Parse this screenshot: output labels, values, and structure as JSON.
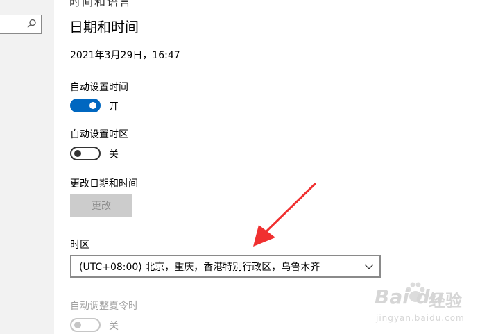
{
  "header": {
    "cut_text": "时间和语言"
  },
  "page": {
    "title": "日期和时间",
    "datetime": "2021年3月29日，16:47"
  },
  "settings": {
    "auto_time": {
      "label": "自动设置时间",
      "state": "开"
    },
    "auto_timezone": {
      "label": "自动设置时区",
      "state": "关"
    },
    "change_datetime": {
      "label": "更改日期和时间",
      "button": "更改"
    },
    "timezone": {
      "label": "时区",
      "value": "(UTC+08:00) 北京，重庆，香港特别行政区，乌鲁木齐"
    },
    "dst": {
      "label": "自动调整夏令时",
      "state": "关"
    }
  },
  "watermark": {
    "brand": "Bai du",
    "exp": "经验",
    "url": "jingyan.baidu.com"
  },
  "colors": {
    "accent": "#0067c0",
    "disabled": "#a0a0a0",
    "button_bg": "#cccccc"
  }
}
